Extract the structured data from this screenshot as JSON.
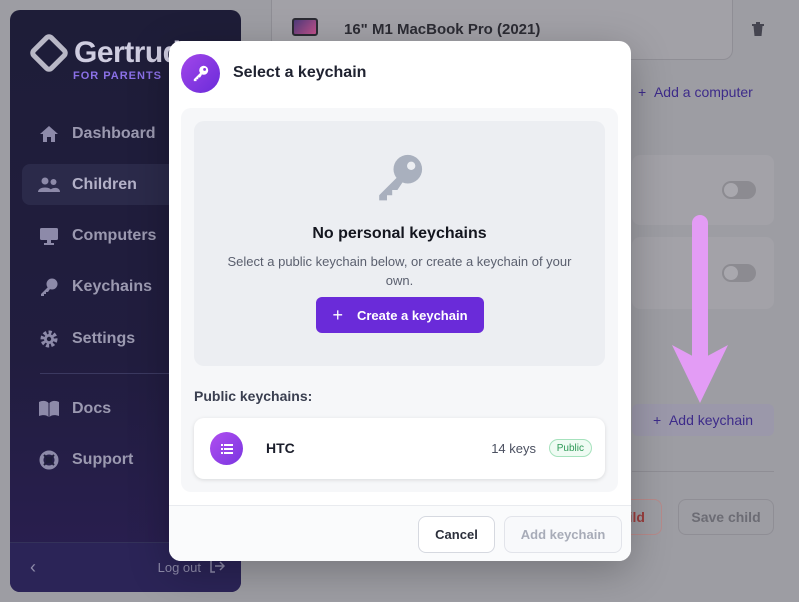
{
  "sidebar": {
    "brand_name": "Gertrud",
    "brand_sub": "FOR PARENTS",
    "items": [
      {
        "label": "Dashboard",
        "icon": "home-icon"
      },
      {
        "label": "Children",
        "icon": "users-icon"
      },
      {
        "label": "Computers",
        "icon": "desktop-icon"
      },
      {
        "label": "Keychains",
        "icon": "key-icon"
      },
      {
        "label": "Settings",
        "icon": "gear-icon"
      }
    ],
    "secondary": [
      {
        "label": "Docs",
        "icon": "book-icon"
      },
      {
        "label": "Support",
        "icon": "lifebuoy-icon"
      }
    ],
    "logout_label": "Log out"
  },
  "background": {
    "computer_name": "16\" M1 MacBook Pro (2021)",
    "add_computer_label": "Add a computer",
    "add_keychain_label": "Add keychain",
    "remove_child_label": "ild",
    "save_child_label": "Save child"
  },
  "modal": {
    "title": "Select a keychain",
    "empty_title": "No personal keychains",
    "empty_desc": "Select a public keychain below, or create a keychain of your own.",
    "create_label": "Create a keychain",
    "public_label": "Public keychains:",
    "keychains": [
      {
        "name": "HTC",
        "count": "14 keys",
        "badge": "Public"
      }
    ],
    "cancel_label": "Cancel",
    "add_label": "Add keychain"
  },
  "colors": {
    "accent": "#6a2bd9",
    "arrow": "#e39cf5"
  }
}
